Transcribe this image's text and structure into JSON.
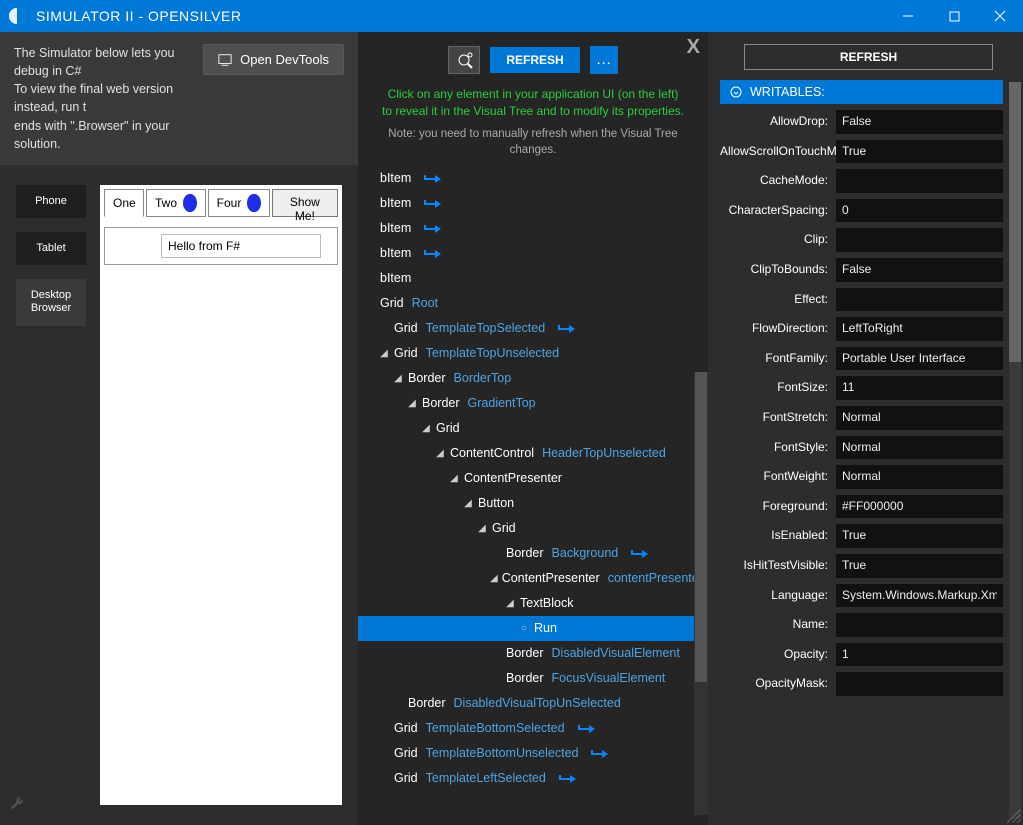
{
  "title": "SIMULATOR II - OPENSILVER",
  "left": {
    "hint": "The Simulator below lets you debug in C#\nTo view the final web version instead, run t\nends with \".Browser\" in your solution.",
    "devtools": "Open DevTools",
    "devices": {
      "phone": "Phone",
      "tablet": "Tablet",
      "desktop": "Desktop Browser"
    },
    "tabs": {
      "one": "One",
      "two": "Two",
      "four": "Four"
    },
    "showme": "Show Me!",
    "inner": "Hello from F#"
  },
  "mid": {
    "refresh": "REFRESH",
    "hintGreen": "Click on any element in your application UI (on the left) to reveal it in the Visual Tree and to modify its properties.",
    "note": "Note: you need to manually refresh when the Visual Tree changes.",
    "tree": [
      {
        "d": 0,
        "e": "",
        "n": "bItem",
        "n2": "",
        "f": 1
      },
      {
        "d": 0,
        "e": "",
        "n": "bItem",
        "n2": "",
        "f": 1
      },
      {
        "d": 0,
        "e": "",
        "n": "bItem",
        "n2": "",
        "f": 1
      },
      {
        "d": 0,
        "e": "",
        "n": "bItem",
        "n2": "",
        "f": 1
      },
      {
        "d": 0,
        "e": "",
        "n": "bItem",
        "n2": "",
        "f": 0
      },
      {
        "d": 0,
        "e": "",
        "n": "Grid",
        "n2": "Root",
        "f": 0
      },
      {
        "d": 1,
        "e": "",
        "n": "Grid",
        "n2": "TemplateTopSelected",
        "f": 1
      },
      {
        "d": 1,
        "e": "▲",
        "n": "Grid",
        "n2": "TemplateTopUnselected",
        "f": 0
      },
      {
        "d": 2,
        "e": "▲",
        "n": "Border",
        "n2": "BorderTop",
        "f": 0
      },
      {
        "d": 3,
        "e": "▲",
        "n": "Border",
        "n2": "GradientTop",
        "f": 0
      },
      {
        "d": 4,
        "e": "▲",
        "n": "Grid",
        "n2": "",
        "f": 0
      },
      {
        "d": 5,
        "e": "▲",
        "n": "ContentControl",
        "n2": "HeaderTopUnselected",
        "f": 0
      },
      {
        "d": 6,
        "e": "▲",
        "n": "ContentPresenter",
        "n2": "",
        "f": 0
      },
      {
        "d": 7,
        "e": "▲",
        "n": "Button",
        "n2": "",
        "f": 0
      },
      {
        "d": 8,
        "e": "▲",
        "n": "Grid",
        "n2": "",
        "f": 0
      },
      {
        "d": 9,
        "e": "",
        "n": "Border",
        "n2": "Background",
        "f": 1
      },
      {
        "d": 9,
        "e": "▲",
        "n": "ContentPresenter",
        "n2": "contentPresenter",
        "f": 0
      },
      {
        "d": 10,
        "e": "▲",
        "n": "TextBlock",
        "n2": "",
        "f": 0
      },
      {
        "d": 11,
        "e": "○",
        "n": "Run",
        "n2": "",
        "f": 0,
        "sel": 1
      },
      {
        "d": 9,
        "e": "",
        "n": "Border",
        "n2": "DisabledVisualElement",
        "f": 0
      },
      {
        "d": 9,
        "e": "",
        "n": "Border",
        "n2": "FocusVisualElement",
        "f": 0
      },
      {
        "d": 2,
        "e": "",
        "n": "Border",
        "n2": "DisabledVisualTopUnSelected",
        "f": 0
      },
      {
        "d": 1,
        "e": "",
        "n": "Grid",
        "n2": "TemplateBottomSelected",
        "f": 1
      },
      {
        "d": 1,
        "e": "",
        "n": "Grid",
        "n2": "TemplateBottomUnselected",
        "f": 1
      },
      {
        "d": 1,
        "e": "",
        "n": "Grid",
        "n2": "TemplateLeftSelected",
        "f": 1
      }
    ]
  },
  "right": {
    "refresh": "REFRESH",
    "section": "WRITABLES:",
    "props": [
      {
        "k": "AllowDrop",
        "v": "False"
      },
      {
        "k": "AllowScrollOnTouchMove",
        "v": "True"
      },
      {
        "k": "CacheMode",
        "v": ""
      },
      {
        "k": "CharacterSpacing",
        "v": "0"
      },
      {
        "k": "Clip",
        "v": ""
      },
      {
        "k": "ClipToBounds",
        "v": "False"
      },
      {
        "k": "Effect",
        "v": ""
      },
      {
        "k": "FlowDirection",
        "v": "LeftToRight"
      },
      {
        "k": "FontFamily",
        "v": "Portable User Interface"
      },
      {
        "k": "FontSize",
        "v": "11"
      },
      {
        "k": "FontStretch",
        "v": "Normal"
      },
      {
        "k": "FontStyle",
        "v": "Normal"
      },
      {
        "k": "FontWeight",
        "v": "Normal"
      },
      {
        "k": "Foreground",
        "v": "#FF000000"
      },
      {
        "k": "IsEnabled",
        "v": "True"
      },
      {
        "k": "IsHitTestVisible",
        "v": "True"
      },
      {
        "k": "Language",
        "v": "System.Windows.Markup.XmlLanguage"
      },
      {
        "k": "Name",
        "v": ""
      },
      {
        "k": "Opacity",
        "v": "1"
      },
      {
        "k": "OpacityMask",
        "v": ""
      }
    ]
  }
}
